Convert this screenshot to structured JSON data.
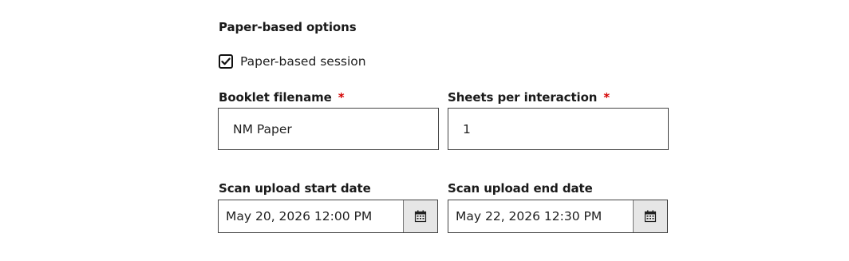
{
  "section": {
    "title": "Paper-based options"
  },
  "paper_session": {
    "label": "Paper-based session",
    "checked": true
  },
  "booklet": {
    "label": "Booklet filename",
    "required_mark": "*",
    "value": "NM Paper"
  },
  "sheets": {
    "label": "Sheets per interaction",
    "required_mark": "*",
    "value": "1"
  },
  "scan_start": {
    "label": "Scan upload start date",
    "value": "May 20, 2026 12:00 PM",
    "icon": "calendar-icon"
  },
  "scan_end": {
    "label": "Scan upload end date",
    "value": "May 22, 2026 12:30 PM",
    "icon": "calendar-icon"
  },
  "colors": {
    "required": "#d40000",
    "border": "#444444",
    "calendar_button_bg": "#e6e6e6"
  }
}
